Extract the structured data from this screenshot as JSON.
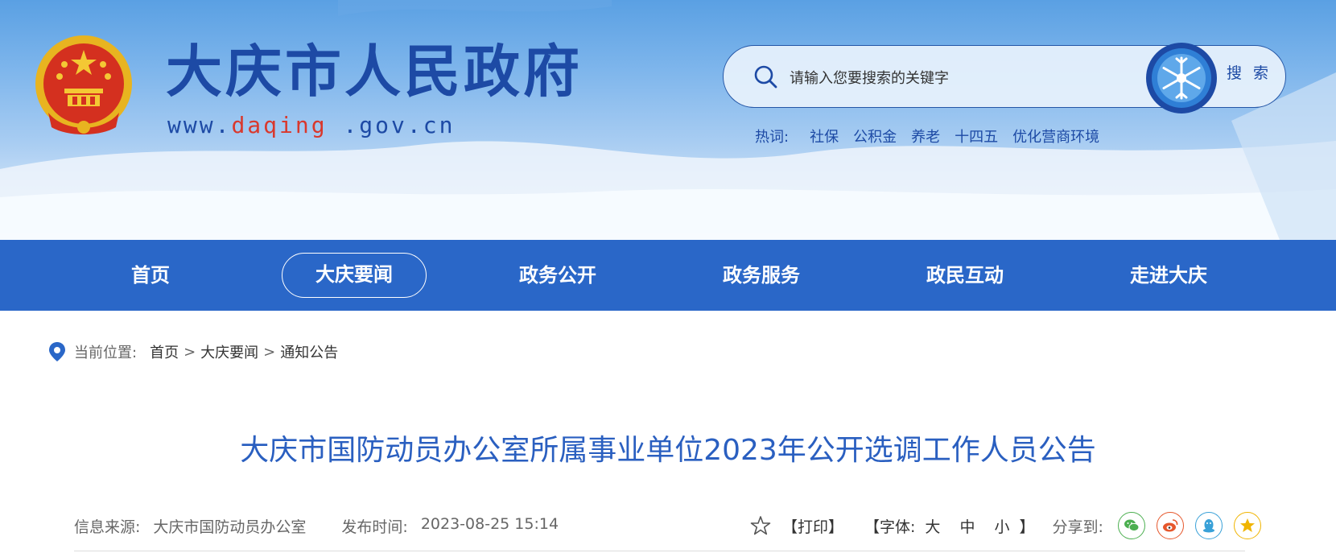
{
  "header": {
    "title": "大庆市人民政府",
    "url_prefix": "www.",
    "url_highlight": "daqing",
    "url_suffix": " .gov.cn"
  },
  "search": {
    "placeholder": "请输入您要搜索的关键字",
    "button_label": "搜 索"
  },
  "hotwords": {
    "label": "热词:",
    "items": [
      "社保",
      "公积金",
      "养老",
      "十四五",
      "优化营商环境"
    ]
  },
  "nav": {
    "items": [
      {
        "label": "首页",
        "active": false
      },
      {
        "label": "大庆要闻",
        "active": true
      },
      {
        "label": "政务公开",
        "active": false
      },
      {
        "label": "政务服务",
        "active": false
      },
      {
        "label": "政民互动",
        "active": false
      },
      {
        "label": "走进大庆",
        "active": false
      }
    ]
  },
  "breadcrumb": {
    "label": "当前位置:",
    "items": [
      "首页",
      "大庆要闻"
    ],
    "separator": ">",
    "current": "通知公告"
  },
  "article": {
    "title": "大庆市国防动员办公室所属事业单位2023年公开选调工作人员公告",
    "source_label": "信息来源:",
    "source": "大庆市国防动员办公室",
    "time_label": "发布时间:",
    "time": "2023-08-25 15:14"
  },
  "tools": {
    "print": "【打印】",
    "font_label": "【字体:",
    "font_large": "大",
    "font_medium": "中",
    "font_small": "小",
    "font_close": "】",
    "share_label": "分享到:",
    "share_icons": [
      "wechat-icon",
      "weibo-icon",
      "qq-icon",
      "qzone-icon"
    ]
  },
  "colors": {
    "brand_blue": "#1d4aa5",
    "nav_blue": "#2a67c8",
    "title_blue": "#2a5fc0",
    "url_red": "#d9382c",
    "wechat": "#4caf50",
    "weibo": "#e6572c",
    "qq": "#39a1d8",
    "qzone": "#f0b400"
  }
}
